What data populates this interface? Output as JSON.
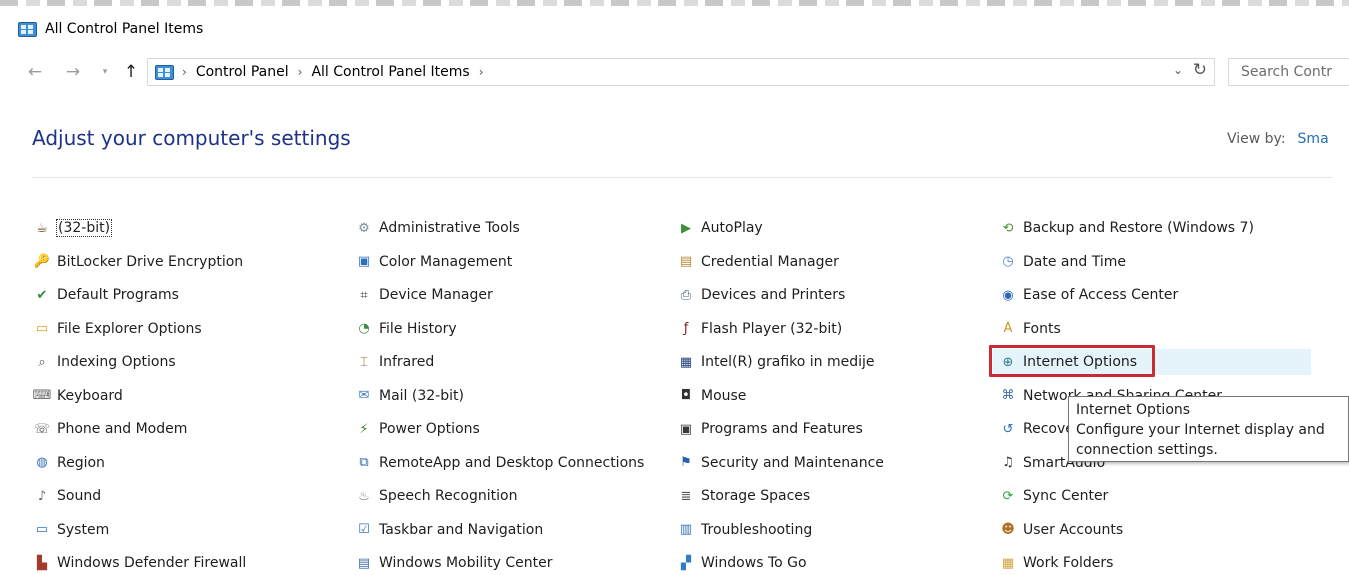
{
  "window": {
    "title": "All Control Panel Items"
  },
  "nav": {
    "back": "←",
    "forward": "→",
    "dropdown": "▾",
    "up": "↑",
    "breadcrumbs": [
      "Control Panel",
      "All Control Panel Items"
    ],
    "crumb_separator": "›",
    "address_dropdown": "⌄",
    "refresh": "↻",
    "search_placeholder": "Search Contr"
  },
  "header": {
    "title": "Adjust your computer's settings",
    "view_by_label": "View by:",
    "view_by_value": "Sma"
  },
  "items": [
    {
      "label": "(32-bit)",
      "icon": "java-icon",
      "glyph": "☕",
      "color": "#6b4b1b"
    },
    {
      "label": "Administrative Tools",
      "icon": "admin-tools-icon",
      "glyph": "⚙",
      "color": "#7a8a99"
    },
    {
      "label": "AutoPlay",
      "icon": "autoplay-icon",
      "glyph": "▶",
      "color": "#3c8f3c"
    },
    {
      "label": "Backup and Restore (Windows 7)",
      "icon": "backup-icon",
      "glyph": "⟲",
      "color": "#4a9a32"
    },
    {
      "label": "BitLocker Drive Encryption",
      "icon": "bitlocker-icon",
      "glyph": "🔑",
      "color": "#c99a2e"
    },
    {
      "label": "Color Management",
      "icon": "color-management-icon",
      "glyph": "▣",
      "color": "#2d6fc4"
    },
    {
      "label": "Credential Manager",
      "icon": "credential-manager-icon",
      "glyph": "▤",
      "color": "#b78a2d"
    },
    {
      "label": "Date and Time",
      "icon": "date-time-icon",
      "glyph": "◷",
      "color": "#4b84c9"
    },
    {
      "label": "Default Programs",
      "icon": "default-programs-icon",
      "glyph": "✔",
      "color": "#2f8a3a"
    },
    {
      "label": "Device Manager",
      "icon": "device-manager-icon",
      "glyph": "⌗",
      "color": "#444444"
    },
    {
      "label": "Devices and Printers",
      "icon": "devices-printers-icon",
      "glyph": "⎙",
      "color": "#44607a"
    },
    {
      "label": "Ease of Access Center",
      "icon": "ease-of-access-icon",
      "glyph": "◉",
      "color": "#2c68b8"
    },
    {
      "label": "File Explorer Options",
      "icon": "file-explorer-options-icon",
      "glyph": "▭",
      "color": "#d8a32a"
    },
    {
      "label": "File History",
      "icon": "file-history-icon",
      "glyph": "◔",
      "color": "#3d8a3d"
    },
    {
      "label": "Flash Player (32-bit)",
      "icon": "flash-player-icon",
      "glyph": "ƒ",
      "color": "#8b1a1a"
    },
    {
      "label": "Fonts",
      "icon": "fonts-icon",
      "glyph": "A",
      "color": "#c9961e"
    },
    {
      "label": "Indexing Options",
      "icon": "indexing-options-icon",
      "glyph": "⌕",
      "color": "#555555"
    },
    {
      "label": "Infrared",
      "icon": "infrared-icon",
      "glyph": "⌶",
      "color": "#8a6a3a"
    },
    {
      "label": "Intel(R) grafiko in medije",
      "icon": "intel-graphics-icon",
      "glyph": "▦",
      "color": "#1d3f7a"
    },
    {
      "label": "Internet Options",
      "icon": "internet-options-icon",
      "glyph": "⊕",
      "color": "#2e7d8c"
    },
    {
      "label": "Keyboard",
      "icon": "keyboard-icon",
      "glyph": "⌨",
      "color": "#666666"
    },
    {
      "label": "Mail (32-bit)",
      "icon": "mail-icon",
      "glyph": "✉",
      "color": "#3a78c2"
    },
    {
      "label": "Mouse",
      "icon": "mouse-icon",
      "glyph": "◘",
      "color": "#333333"
    },
    {
      "label": "Network and Sharing Center",
      "icon": "network-sharing-icon",
      "glyph": "⌘",
      "color": "#3b6fb0"
    },
    {
      "label": "Phone and Modem",
      "icon": "phone-modem-icon",
      "glyph": "☏",
      "color": "#5a5a5a"
    },
    {
      "label": "Power Options",
      "icon": "power-options-icon",
      "glyph": "⚡",
      "color": "#3c8a2e"
    },
    {
      "label": "Programs and Features",
      "icon": "programs-features-icon",
      "glyph": "▣",
      "color": "#3a3a3a"
    },
    {
      "label": "Recovery",
      "icon": "recovery-icon",
      "glyph": "↺",
      "color": "#2e6fb4"
    },
    {
      "label": "Region",
      "icon": "region-icon",
      "glyph": "◍",
      "color": "#2f6fb6"
    },
    {
      "label": "RemoteApp and Desktop Connections",
      "icon": "remoteapp-icon",
      "glyph": "⧉",
      "color": "#2b63a8"
    },
    {
      "label": "Security and Maintenance",
      "icon": "security-maintenance-icon",
      "glyph": "⚑",
      "color": "#2b5fb0"
    },
    {
      "label": "SmartAudio",
      "icon": "smartaudio-icon",
      "glyph": "♫",
      "color": "#333333"
    },
    {
      "label": "Sound",
      "icon": "sound-icon",
      "glyph": "♪",
      "color": "#666666"
    },
    {
      "label": "Speech Recognition",
      "icon": "speech-recognition-icon",
      "glyph": "♨",
      "color": "#777777"
    },
    {
      "label": "Storage Spaces",
      "icon": "storage-spaces-icon",
      "glyph": "≣",
      "color": "#555555"
    },
    {
      "label": "Sync Center",
      "icon": "sync-center-icon",
      "glyph": "⟳",
      "color": "#34a03a"
    },
    {
      "label": "System",
      "icon": "system-icon",
      "glyph": "▭",
      "color": "#2f78c6"
    },
    {
      "label": "Taskbar and Navigation",
      "icon": "taskbar-navigation-icon",
      "glyph": "☑",
      "color": "#3c6fb4"
    },
    {
      "label": "Troubleshooting",
      "icon": "troubleshooting-icon",
      "glyph": "▥",
      "color": "#2f6fb6"
    },
    {
      "label": "User Accounts",
      "icon": "user-accounts-icon",
      "glyph": "☻",
      "color": "#b0722a"
    },
    {
      "label": "Windows Defender Firewall",
      "icon": "windows-firewall-icon",
      "glyph": "▙",
      "color": "#a33a2a"
    },
    {
      "label": "Windows Mobility Center",
      "icon": "windows-mobility-icon",
      "glyph": "▤",
      "color": "#3d6fa8"
    },
    {
      "label": "Windows To Go",
      "icon": "windows-to-go-icon",
      "glyph": "▞",
      "color": "#2e7fc4"
    },
    {
      "label": "Work Folders",
      "icon": "work-folders-icon",
      "glyph": "▦",
      "color": "#d1a23a"
    }
  ],
  "tooltip": {
    "title": "Internet Options",
    "description_line1": "Configure your Internet display and",
    "description_line2": "connection settings."
  },
  "colors": {
    "link_blue": "#1e3287",
    "hover_bg": "#e5f3fb",
    "highlight_red": "#c92b33"
  }
}
